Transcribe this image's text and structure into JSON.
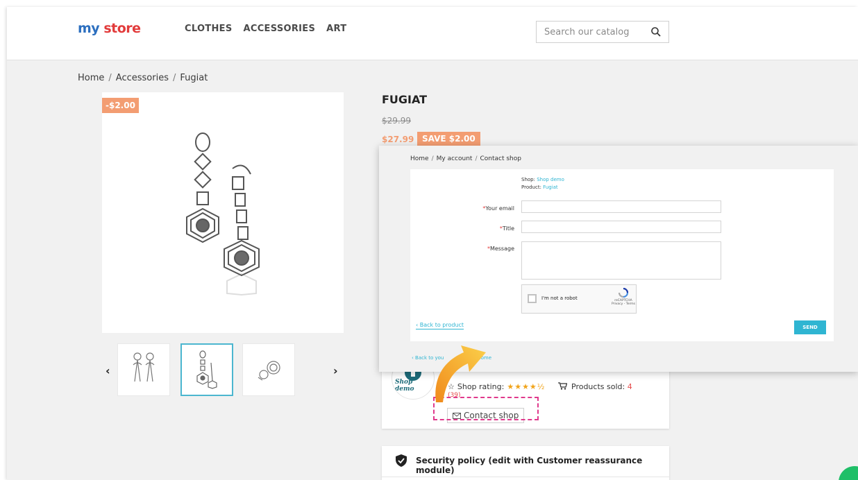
{
  "header": {
    "logo_part1": "my ",
    "logo_part2": "store",
    "nav": [
      "CLOTHES",
      "ACCESSORIES",
      "ART"
    ],
    "search_placeholder": "Search our catalog"
  },
  "breadcrumb": [
    "Home",
    "Accessories",
    "Fugiat"
  ],
  "product": {
    "discount_flag": "-$2.00",
    "title": "FUGIAT",
    "old_price": "$29.99",
    "new_price": "$27.99",
    "save_label": "SAVE $2.00",
    "thumb_prev": "‹",
    "thumb_next": "›"
  },
  "shop_card": {
    "logo_text": "Shop demo",
    "rating_label": "Shop rating:",
    "stars": "★★★★½",
    "rating_count": "(39)",
    "products_sold_label": "Products sold:",
    "products_sold_value": "4",
    "contact_button": "Contact shop"
  },
  "reassurance": {
    "title": "Security policy (edit with Customer reassurance module)"
  },
  "contact_modal": {
    "breadcrumb": [
      "Home",
      "My account",
      "Contact shop"
    ],
    "shop_label": "Shop:",
    "shop_value": "Shop demo",
    "product_label": "Product:",
    "product_value": "Fugiat",
    "required_mark": "*",
    "email_label": "Your email",
    "title_label": "Title",
    "message_label": "Message",
    "recaptcha_text": "I'm not a robot",
    "recaptcha_brand": "reCAPTCHA",
    "recaptcha_links": "Privacy - Terms",
    "back_to_product": "‹ Back to product",
    "send_button": "SEND",
    "footer_back": "‹ Back to you",
    "footer_home": "Home"
  },
  "colors": {
    "accent": "#2fb5d2",
    "sale": "#f39d72",
    "highlight_dash": "#e0398c",
    "pointer_arrow": "#f6a623"
  }
}
